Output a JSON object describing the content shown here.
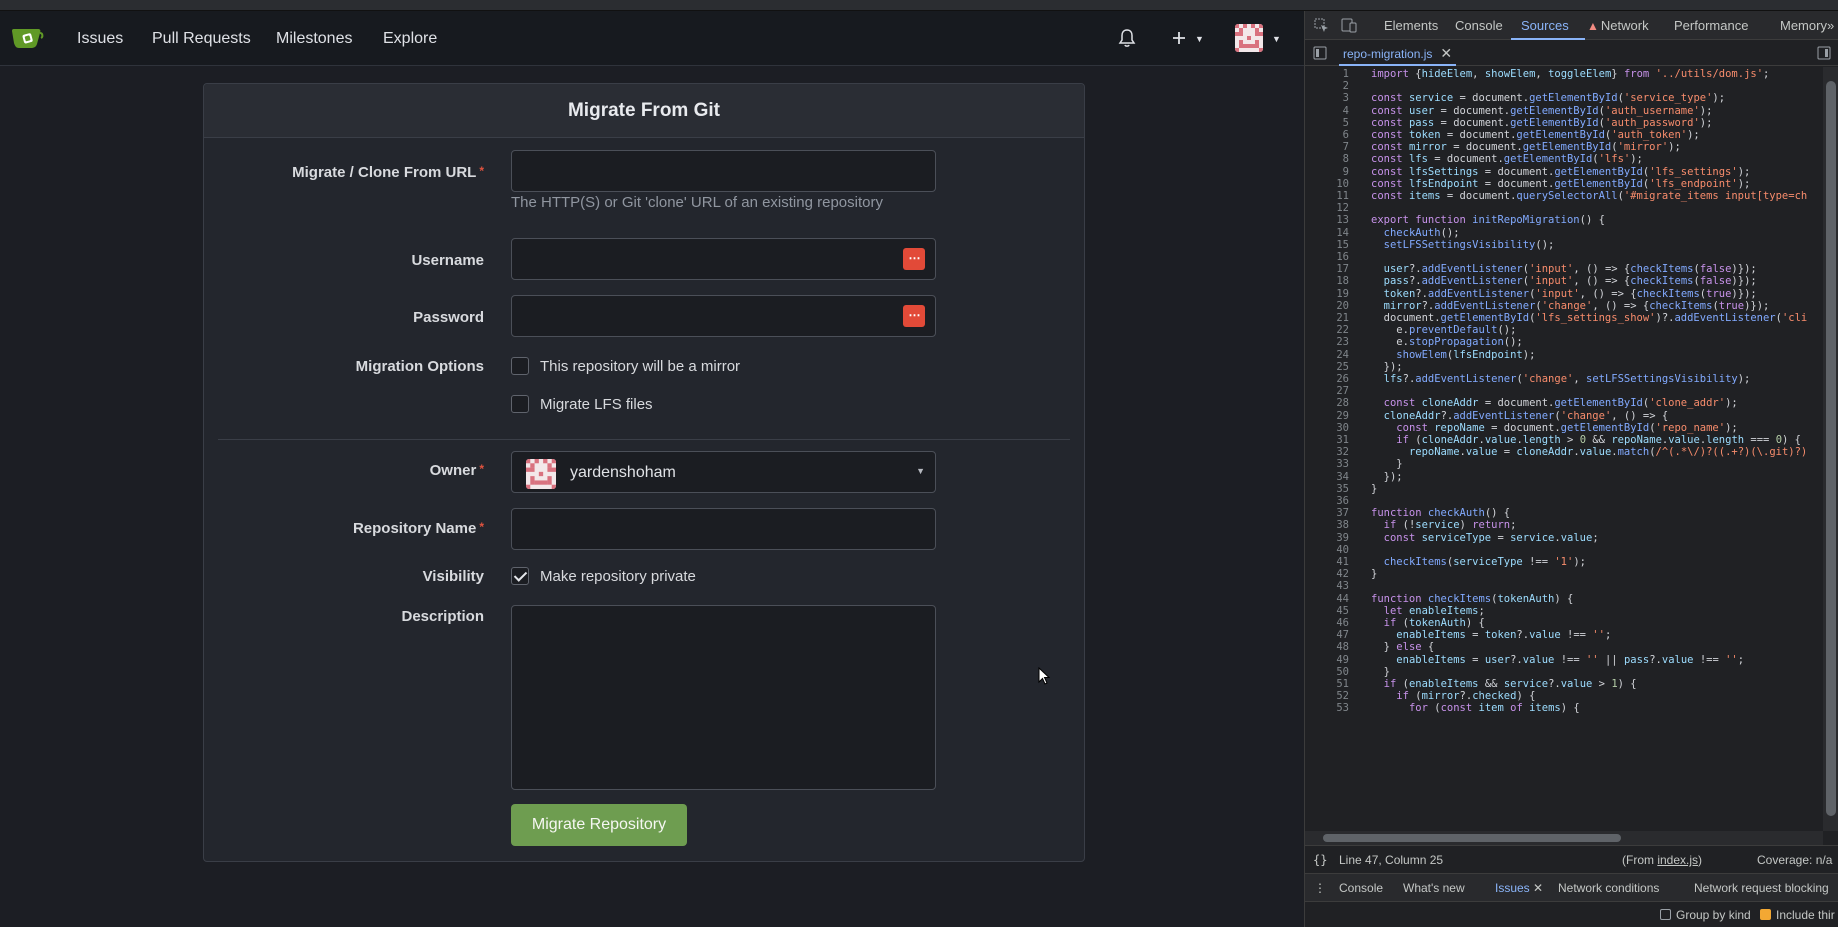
{
  "nav": {
    "items": [
      "Issues",
      "Pull Requests",
      "Milestones",
      "Explore"
    ],
    "bell_icon": "bell-icon",
    "plus_icon": "plus-icon"
  },
  "form": {
    "title": "Migrate From Git",
    "clone_url_label": "Migrate / Clone From URL",
    "clone_url_value": "",
    "clone_url_help": "The HTTP(S) or Git 'clone' URL of an existing repository",
    "username_label": "Username",
    "username_value": "",
    "password_label": "Password",
    "password_value": "",
    "password_manager_icon": "⋯",
    "migration_options_label": "Migration Options",
    "mirror_label": "This repository will be a mirror",
    "mirror_checked": false,
    "lfs_label": "Migrate LFS files",
    "lfs_checked": false,
    "owner_label": "Owner",
    "owner_value": "yardenshoham",
    "repo_name_label": "Repository Name",
    "repo_name_value": "",
    "visibility_label": "Visibility",
    "private_label": "Make repository private",
    "private_checked": true,
    "description_label": "Description",
    "description_value": "",
    "required_mark": "*",
    "submit_label": "Migrate Repository"
  },
  "colors": {
    "accent": "#6e9d50",
    "required": "#e0533f",
    "devtools_accent": "#8ab4f8"
  },
  "devtools": {
    "tabs": [
      "Elements",
      "Console",
      "Sources",
      "Network",
      "Performance",
      "Memory"
    ],
    "active_tab": "Sources",
    "more_tabs": "»",
    "file_tab": "repo-migration.js",
    "code_lines": [
      {
        "n": "1",
        "html": "<span class=\"kw\">import</span> {<span class=\"var\">hideElem</span>, <span class=\"var\">showElem</span>, <span class=\"var\">toggleElem</span>} <span class=\"kw\">from</span> <span class=\"str\">'../utils/dom.js'</span>;"
      },
      {
        "n": "2",
        "html": ""
      },
      {
        "n": "3",
        "html": "<span class=\"kw\">const</span> <span class=\"var\">service</span> = document.<span class=\"fn\">getElementById</span>(<span class=\"str\">'service_type'</span>);"
      },
      {
        "n": "4",
        "html": "<span class=\"kw\">const</span> <span class=\"var\">user</span> = document.<span class=\"fn\">getElementById</span>(<span class=\"str\">'auth_username'</span>);"
      },
      {
        "n": "5",
        "html": "<span class=\"kw\">const</span> <span class=\"var\">pass</span> = document.<span class=\"fn\">getElementById</span>(<span class=\"str\">'auth_password'</span>);"
      },
      {
        "n": "6",
        "html": "<span class=\"kw\">const</span> <span class=\"var\">token</span> = document.<span class=\"fn\">getElementById</span>(<span class=\"str\">'auth_token'</span>);"
      },
      {
        "n": "7",
        "html": "<span class=\"kw\">const</span> <span class=\"var\">mirror</span> = document.<span class=\"fn\">getElementById</span>(<span class=\"str\">'mirror'</span>);"
      },
      {
        "n": "8",
        "html": "<span class=\"kw\">const</span> <span class=\"var\">lfs</span> = document.<span class=\"fn\">getElementById</span>(<span class=\"str\">'lfs'</span>);"
      },
      {
        "n": "9",
        "html": "<span class=\"kw\">const</span> <span class=\"var\">lfsSettings</span> = document.<span class=\"fn\">getElementById</span>(<span class=\"str\">'lfs_settings'</span>);"
      },
      {
        "n": "10",
        "html": "<span class=\"kw\">const</span> <span class=\"var\">lfsEndpoint</span> = document.<span class=\"fn\">getElementById</span>(<span class=\"str\">'lfs_endpoint'</span>);"
      },
      {
        "n": "11",
        "html": "<span class=\"kw\">const</span> <span class=\"var\">items</span> = document.<span class=\"fn\">querySelectorAll</span>(<span class=\"str\">'#migrate_items input[type=ch</span>"
      },
      {
        "n": "12",
        "html": ""
      },
      {
        "n": "13",
        "html": "<span class=\"kw\">export function</span> <span class=\"fn\">initRepoMigration</span>() {"
      },
      {
        "n": "14",
        "html": "  <span class=\"fn\">checkAuth</span>();"
      },
      {
        "n": "15",
        "html": "  <span class=\"fn\">setLFSSettingsVisibility</span>();"
      },
      {
        "n": "16",
        "html": ""
      },
      {
        "n": "17",
        "html": "  <span class=\"var\">user</span>?.<span class=\"fn\">addEventListener</span>(<span class=\"str\">'input'</span>, () => {<span class=\"fn\">checkItems</span>(<span class=\"kw\">false</span>)});"
      },
      {
        "n": "18",
        "html": "  <span class=\"var\">pass</span>?.<span class=\"fn\">addEventListener</span>(<span class=\"str\">'input'</span>, () => {<span class=\"fn\">checkItems</span>(<span class=\"kw\">false</span>)});"
      },
      {
        "n": "19",
        "html": "  <span class=\"var\">token</span>?.<span class=\"fn\">addEventListener</span>(<span class=\"str\">'input'</span>, () => {<span class=\"fn\">checkItems</span>(<span class=\"kw\">true</span>)});"
      },
      {
        "n": "20",
        "html": "  <span class=\"var\">mirror</span>?.<span class=\"fn\">addEventListener</span>(<span class=\"str\">'change'</span>, () => {<span class=\"fn\">checkItems</span>(<span class=\"kw\">true</span>)});"
      },
      {
        "n": "21",
        "html": "  document.<span class=\"fn\">getElementById</span>(<span class=\"str\">'lfs_settings_show'</span>)?.<span class=\"fn\">addEventListener</span>(<span class=\"str\">'cli</span>"
      },
      {
        "n": "22",
        "html": "    e.<span class=\"fn\">preventDefault</span>();"
      },
      {
        "n": "23",
        "html": "    e.<span class=\"fn\">stopPropagation</span>();"
      },
      {
        "n": "24",
        "html": "    <span class=\"fn\">showElem</span>(<span class=\"var\">lfsEndpoint</span>);"
      },
      {
        "n": "25",
        "html": "  });"
      },
      {
        "n": "26",
        "html": "  <span class=\"var\">lfs</span>?.<span class=\"fn\">addEventListener</span>(<span class=\"str\">'change'</span>, <span class=\"fn\">setLFSSettingsVisibility</span>);"
      },
      {
        "n": "27",
        "html": ""
      },
      {
        "n": "28",
        "html": "  <span class=\"kw\">const</span> <span class=\"var\">cloneAddr</span> = document.<span class=\"fn\">getElementById</span>(<span class=\"str\">'clone_addr'</span>);"
      },
      {
        "n": "29",
        "html": "  <span class=\"var\">cloneAddr</span>?.<span class=\"fn\">addEventListener</span>(<span class=\"str\">'change'</span>, () => {"
      },
      {
        "n": "30",
        "html": "    <span class=\"kw\">const</span> <span class=\"var\">repoName</span> = document.<span class=\"fn\">getElementById</span>(<span class=\"str\">'repo_name'</span>);"
      },
      {
        "n": "31",
        "html": "    <span class=\"kw\">if</span> (<span class=\"var\">cloneAddr</span>.<span class=\"var\">value</span>.<span class=\"var\">length</span> > <span class=\"num\">0</span> && <span class=\"var\">repoName</span>.<span class=\"var\">value</span>.<span class=\"var\">length</span> === <span class=\"num\">0</span>) {"
      },
      {
        "n": "32",
        "html": "      <span class=\"var\">repoName</span>.<span class=\"var\">value</span> = <span class=\"var\">cloneAddr</span>.<span class=\"var\">value</span>.<span class=\"fn\">match</span>(<span class=\"str\">/^(.*\\/)?((.+?)(\\.git)?)</span>"
      },
      {
        "n": "33",
        "html": "    }"
      },
      {
        "n": "34",
        "html": "  });"
      },
      {
        "n": "35",
        "html": "}"
      },
      {
        "n": "36",
        "html": ""
      },
      {
        "n": "37",
        "html": "<span class=\"kw\">function</span> <span class=\"fn\">checkAuth</span>() {"
      },
      {
        "n": "38",
        "html": "  <span class=\"kw\">if</span> (!<span class=\"var\">service</span>) <span class=\"kw\">return</span>;"
      },
      {
        "n": "39",
        "html": "  <span class=\"kw\">const</span> <span class=\"var\">serviceType</span> = <span class=\"var\">service</span>.<span class=\"var\">value</span>;"
      },
      {
        "n": "40",
        "html": ""
      },
      {
        "n": "41",
        "html": "  <span class=\"fn\">checkItems</span>(<span class=\"var\">serviceType</span> !== <span class=\"str\">'1'</span>);"
      },
      {
        "n": "42",
        "html": "}"
      },
      {
        "n": "43",
        "html": ""
      },
      {
        "n": "44",
        "html": "<span class=\"kw\">function</span> <span class=\"fn\">checkItems</span>(<span class=\"var\">tokenAuth</span>) {"
      },
      {
        "n": "45",
        "html": "  <span class=\"kw\">let</span> <span class=\"var\">enableItems</span>;"
      },
      {
        "n": "46",
        "html": "  <span class=\"kw\">if</span> (<span class=\"var\">tokenAuth</span>) {"
      },
      {
        "n": "47",
        "html": "    <span class=\"var\">enableItems</span> = <span class=\"var\">token</span>?.<span class=\"var\">value</span> !== <span class=\"str\">''</span>;"
      },
      {
        "n": "48",
        "html": "  } <span class=\"kw\">else</span> {"
      },
      {
        "n": "49",
        "html": "    <span class=\"var\">enableItems</span> = <span class=\"var\">user</span>?.<span class=\"var\">value</span> !== <span class=\"str\">''</span> || <span class=\"var\">pass</span>?.<span class=\"var\">value</span> !== <span class=\"str\">''</span>;"
      },
      {
        "n": "50",
        "html": "  }"
      },
      {
        "n": "51",
        "html": "  <span class=\"kw\">if</span> (<span class=\"var\">enableItems</span> && <span class=\"var\">service</span>?.<span class=\"var\">value</span> > <span class=\"num\">1</span>) {"
      },
      {
        "n": "52",
        "html": "    <span class=\"kw\">if</span> (<span class=\"var\">mirror</span>?.<span class=\"var\">checked</span>) {"
      },
      {
        "n": "53",
        "html": "      <span class=\"kw\">for</span> (<span class=\"kw\">const</span> <span class=\"var\">item</span> <span class=\"kw\">of</span> <span class=\"var\">items</span>) {"
      }
    ],
    "status": {
      "position": "Line 47, Column 25",
      "from_prefix": "(From ",
      "from_file": "index.js",
      "from_suffix": ")",
      "coverage": "Coverage: n/a"
    },
    "drawer_tabs": [
      "Console",
      "What's new",
      "Issues",
      "Network conditions",
      "Network request blocking"
    ],
    "drawer_active": "Issues",
    "drawer_options": {
      "group_by_kind": "Group by kind",
      "group_by_kind_checked": false,
      "include_third": "Include thir",
      "include_third_checked": true
    }
  }
}
